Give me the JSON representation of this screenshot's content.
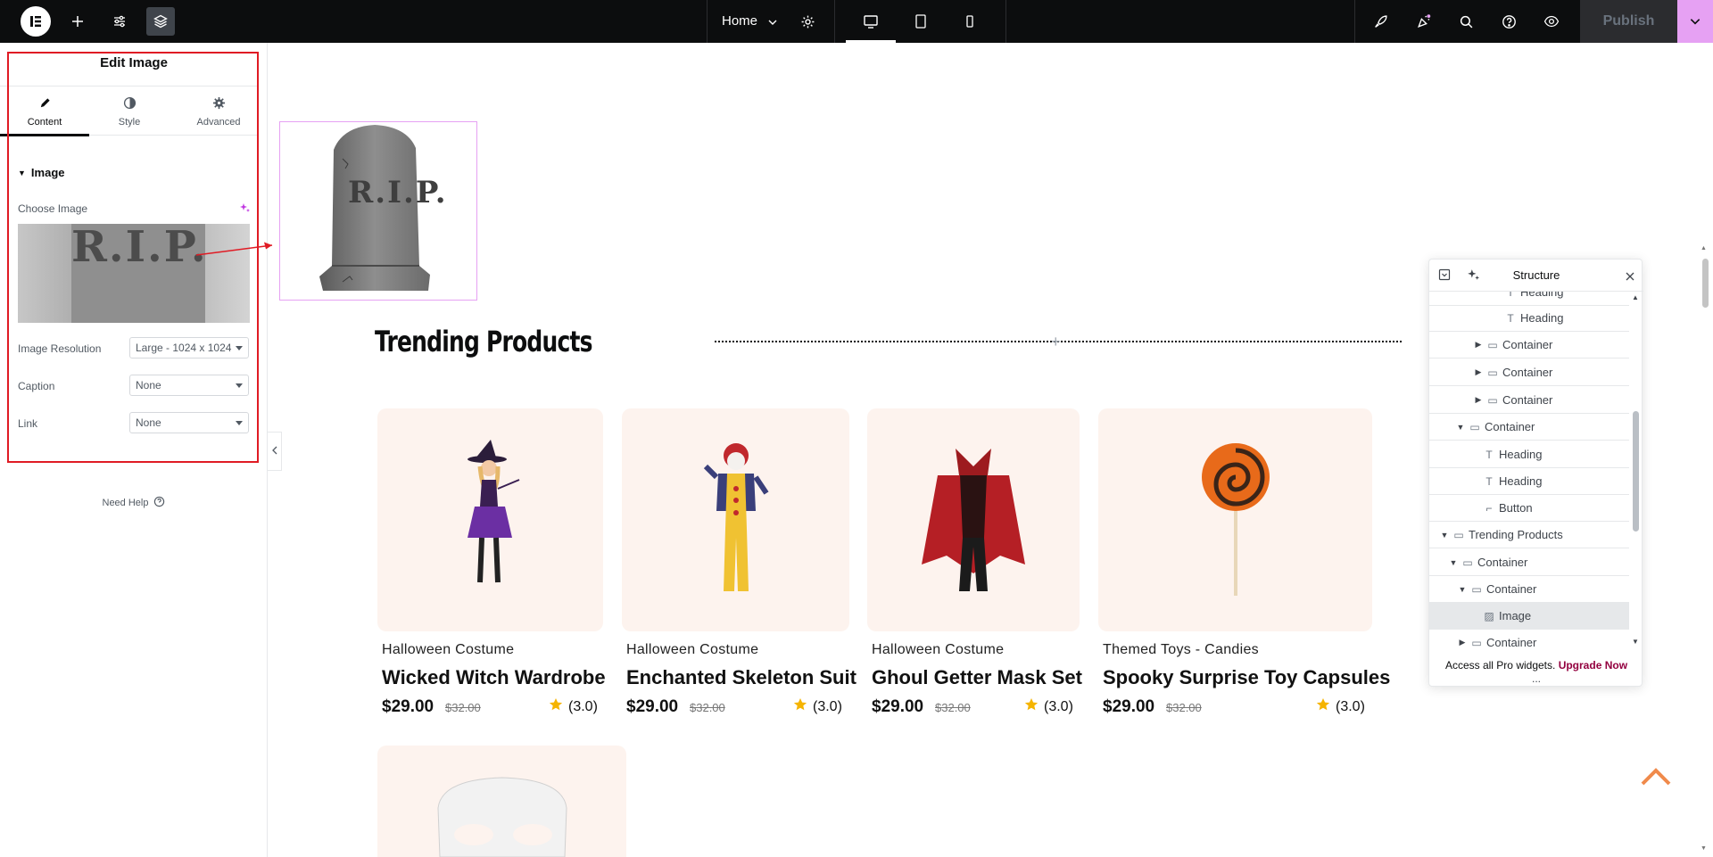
{
  "topbar": {
    "page_name": "Home",
    "publish_label": "Publish",
    "icons": [
      "elementor-logo-icon",
      "add-icon",
      "site-settings-icon",
      "structure-icon",
      "settings-icon",
      "desktop-icon",
      "tablet-icon",
      "mobile-icon",
      "launchpad-icon",
      "whats-new-icon",
      "search-icon",
      "help-icon",
      "preview-icon",
      "chevron-down-icon"
    ]
  },
  "panel": {
    "title": "Edit Image",
    "tabs": [
      {
        "label": "Content",
        "icon": "pencil-icon"
      },
      {
        "label": "Style",
        "icon": "contrast-icon"
      },
      {
        "label": "Advanced",
        "icon": "gear-icon"
      }
    ],
    "section_title": "Image",
    "choose_image_label": "Choose Image",
    "preview_text": "R.I.P.",
    "resolution_label": "Image Resolution",
    "resolution_value": "Large - 1024 x 1024",
    "caption_label": "Caption",
    "caption_value": "None",
    "link_label": "Link",
    "link_value": "None",
    "need_help": "Need Help"
  },
  "canvas": {
    "tomb_text": "R.I.P.",
    "section_title": "Trending Products",
    "products": [
      {
        "category": "Halloween Costume",
        "name": "Wicked Witch Wardrobe",
        "price": "$29.00",
        "old_price": "$32.00",
        "rating": "(3.0)"
      },
      {
        "category": "Halloween Costume",
        "name": "Enchanted Skeleton Suit",
        "price": "$29.00",
        "old_price": "$32.00",
        "rating": "(3.0)"
      },
      {
        "category": "Halloween Costume",
        "name": "Ghoul Getter Mask Set",
        "price": "$29.00",
        "old_price": "$32.00",
        "rating": "(3.0)"
      },
      {
        "category": "Themed Toys - Candies",
        "name": "Spooky Surprise Toy Capsules",
        "price": "$29.00",
        "old_price": "$32.00",
        "rating": "(3.0)"
      }
    ]
  },
  "structure": {
    "title": "Structure",
    "rows": [
      {
        "label": "Heading",
        "type": "heading"
      },
      {
        "label": "Heading",
        "type": "heading"
      },
      {
        "label": "Container",
        "type": "container",
        "toggle": "collapsed"
      },
      {
        "label": "Container",
        "type": "container",
        "toggle": "collapsed"
      },
      {
        "label": "Container",
        "type": "container",
        "toggle": "collapsed"
      },
      {
        "label": "Container",
        "type": "container",
        "toggle": "expanded"
      },
      {
        "label": "Heading",
        "type": "heading"
      },
      {
        "label": "Heading",
        "type": "heading"
      },
      {
        "label": "Button",
        "type": "button"
      },
      {
        "label": "Trending Products",
        "type": "container",
        "toggle": "expanded"
      },
      {
        "label": "Container",
        "type": "container",
        "toggle": "expanded"
      },
      {
        "label": "Container",
        "type": "container",
        "toggle": "expanded"
      },
      {
        "label": "Image",
        "type": "image",
        "selected": true
      },
      {
        "label": "Container",
        "type": "container",
        "toggle": "collapsed"
      }
    ],
    "footer_text": "Access all Pro widgets.",
    "footer_link": "Upgrade Now",
    "more": "..."
  },
  "colors": {
    "accent": "#e6a1f3",
    "outline": "#e01b24",
    "upgrade": "#93003f",
    "to_top": "#f08a4b",
    "star": "#f5b400"
  }
}
